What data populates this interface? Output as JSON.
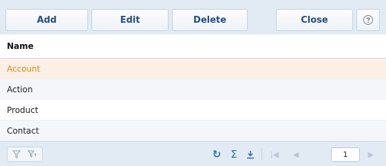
{
  "toolbar": {
    "add_label": "Add",
    "edit_label": "Edit",
    "delete_label": "Delete",
    "close_label": "Close",
    "help_icon": "help-icon"
  },
  "grid": {
    "column_header": "Name",
    "rows": [
      "Account",
      "Action",
      "Product",
      "Contact"
    ],
    "selected_row": "Account",
    "selected_color": "#f0871e"
  },
  "footer": {
    "icons": [
      "filter-icon",
      "advanced-filter-icon",
      "refresh-icon",
      "summary-icon",
      "export-icon",
      "first-page-icon",
      "previous-page-icon",
      "next-page-icon"
    ],
    "page_value": "1"
  },
  "colors": {
    "toolbar_bg": "#e2ebf4",
    "button_text": "#1f4e8c",
    "accent": "#2e6fb8"
  }
}
